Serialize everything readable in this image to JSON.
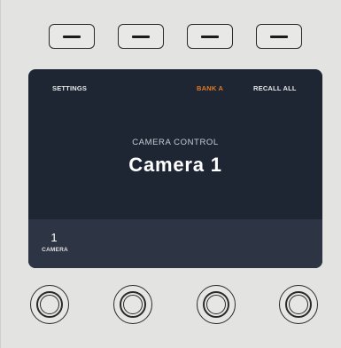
{
  "soft_buttons": [
    {
      "icon": "dash-icon"
    },
    {
      "icon": "dash-icon"
    },
    {
      "icon": "dash-icon"
    },
    {
      "icon": "dash-icon"
    }
  ],
  "screen": {
    "menu": {
      "settings_label": "SETTINGS",
      "bank_label": "BANK A",
      "recall_label": "RECALL ALL"
    },
    "section_label": "CAMERA CONTROL",
    "camera_name": "Camera 1",
    "camera_value": "1",
    "camera_caption": "CAMERA"
  },
  "colors": {
    "screen_bg": "#1f2633",
    "active_accent": "#e07a24",
    "panel_bg": "#e3e3e2"
  },
  "knobs": [
    {
      "name": "knob-1"
    },
    {
      "name": "knob-2"
    },
    {
      "name": "knob-3"
    },
    {
      "name": "knob-4"
    }
  ]
}
